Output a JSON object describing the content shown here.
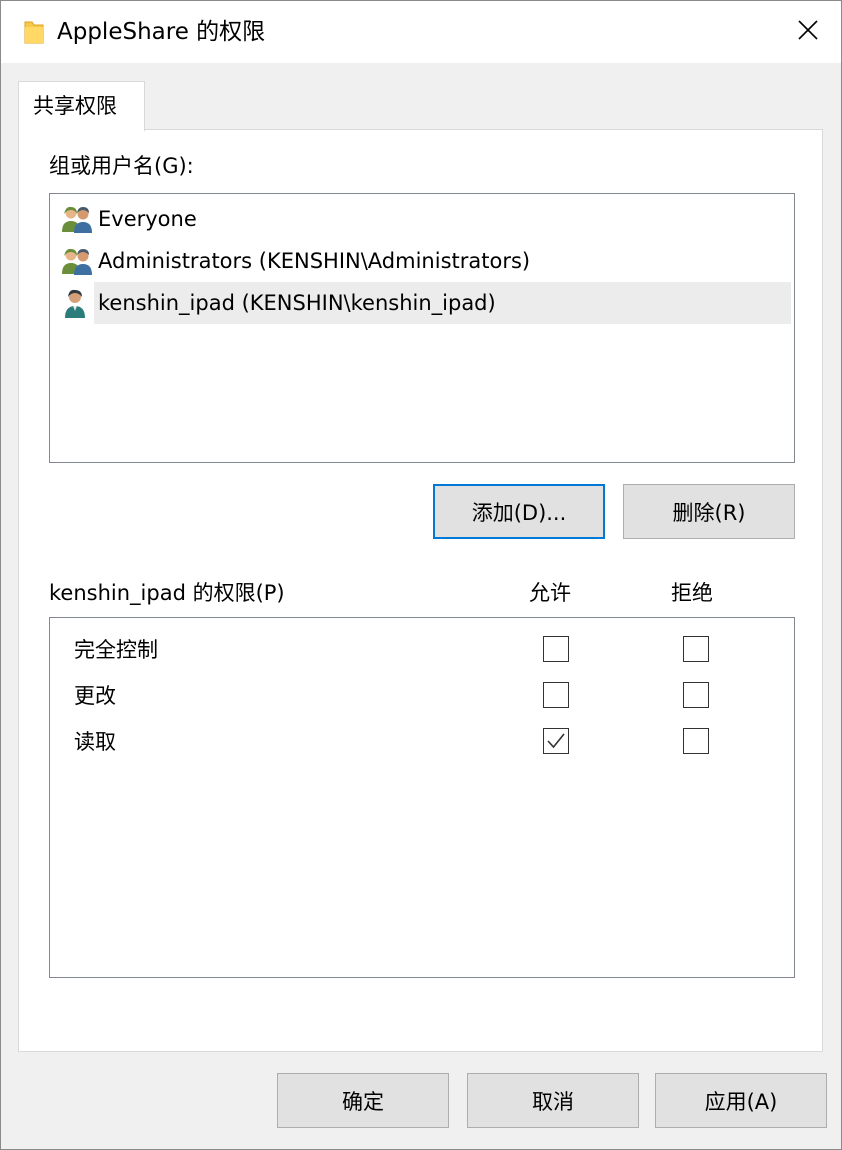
{
  "window": {
    "title": "AppleShare 的权限",
    "close_glyph": "✕",
    "icon": "folder-icon"
  },
  "tabs": [
    {
      "label": "共享权限",
      "active": true
    }
  ],
  "group_section": {
    "label": "组或用户名(G):",
    "items": [
      {
        "label": "Everyone",
        "icon": "group-icon",
        "selected": false
      },
      {
        "label": "Administrators (KENSHIN\\Administrators)",
        "icon": "group-icon",
        "selected": true
      },
      {
        "label": "kenshin_ipad (KENSHIN\\kenshin_ipad)",
        "icon": "user-icon",
        "selected": true
      }
    ],
    "add_button": "添加(D)...",
    "remove_button": "删除(R)"
  },
  "permissions_section": {
    "label": "kenshin_ipad 的权限(P)",
    "allow_header": "允许",
    "deny_header": "拒绝",
    "rows": [
      {
        "name": "完全控制",
        "allow": false,
        "deny": false
      },
      {
        "name": "更改",
        "allow": false,
        "deny": false
      },
      {
        "name": "读取",
        "allow": true,
        "deny": false
      }
    ]
  },
  "footer": {
    "ok_button": "确定",
    "cancel_button": "取消",
    "apply_button": "应用(A)"
  },
  "colors": {
    "focus_border": "#0078d7",
    "folder": "#f7c948",
    "selection_bg": "#ececec"
  }
}
